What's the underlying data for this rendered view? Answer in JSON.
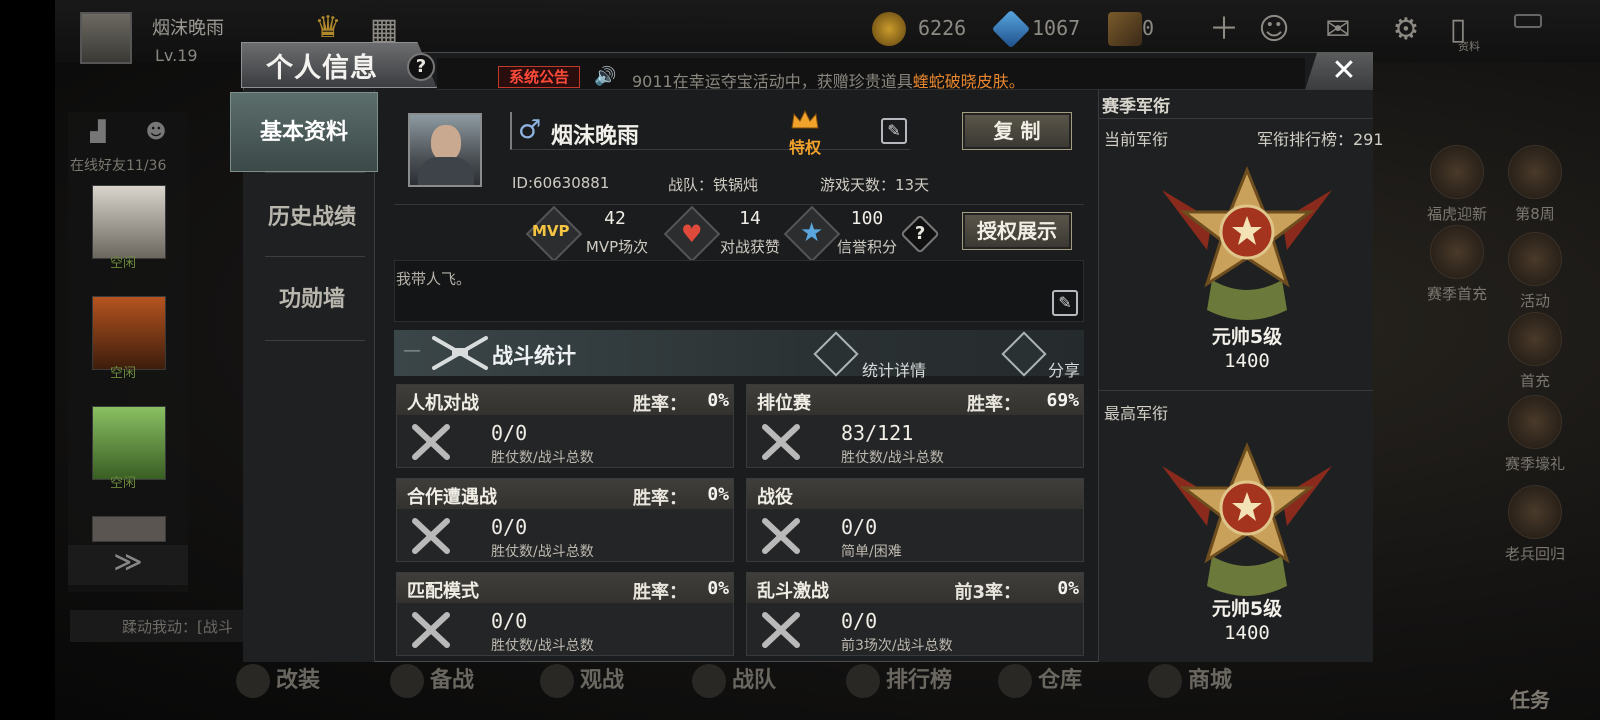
{
  "topbar": {
    "player_name": "烟沫晚雨",
    "level": "Lv.19",
    "gold": "6226",
    "diamonds": "1067",
    "tickets": "0",
    "book_label": "资料"
  },
  "friends": {
    "online_count": "在线好友11/36",
    "status_idle": "空闲",
    "chat_preview": "蹂动我动：[战斗"
  },
  "right_menu": [
    "福虎迎新",
    "第8周",
    "赛季首充",
    "活动",
    "首充",
    "赛季壕礼",
    "老兵回归"
  ],
  "bottom_nav": [
    "改装",
    "备战",
    "观战",
    "战队",
    "排行榜",
    "仓库",
    "商城"
  ],
  "task_label": "任务",
  "modal": {
    "title": "个人信息",
    "help": "?",
    "notice_badge": "系统公告",
    "notice_text": "9011在幸运夺宝活动中，获赠珍贵道具",
    "notice_highlight": "蝰蛇破晓皮肤。",
    "close": "✕"
  },
  "tabs": [
    "基本资料",
    "历史战绩",
    "功勋墙"
  ],
  "profile": {
    "gender_symbol": "♂",
    "name": "烟沫晚雨",
    "privilege": "特权",
    "copy_button": "复 制",
    "id": "ID:60630881",
    "team": "战队：铁锅炖",
    "days": "游戏天数：13天",
    "mvp_icon": "MVP",
    "mvp_count": "42",
    "mvp_label": "MVP场次",
    "likes_count": "14",
    "likes_label": "对战获赞",
    "credit_count": "100",
    "credit_label": "信誉积分",
    "auth_button": "授权展示",
    "motto": "我带人飞。"
  },
  "battle": {
    "title": "战斗统计",
    "details_link": "统计详情",
    "share_link": "分享",
    "cards": [
      {
        "title": "人机对战",
        "rate_label": "胜率：",
        "rate": "0%",
        "value": "0/0",
        "sub": "胜仗数/战斗总数"
      },
      {
        "title": "排位赛",
        "rate_label": "胜率：",
        "rate": "69%",
        "value": "83/121",
        "sub": "胜仗数/战斗总数"
      },
      {
        "title": "合作遭遇战",
        "rate_label": "胜率：",
        "rate": "0%",
        "value": "0/0",
        "sub": "胜仗数/战斗总数"
      },
      {
        "title": "战役",
        "rate_label": "",
        "rate": "",
        "value": "0/0",
        "sub": "简单/困难"
      },
      {
        "title": "匹配模式",
        "rate_label": "胜率：",
        "rate": "0%",
        "value": "0/0",
        "sub": "胜仗数/战斗总数"
      },
      {
        "title": "乱斗激战",
        "rate_label": "前3率：",
        "rate": "0%",
        "value": "0/0",
        "sub": "前3场次/战斗总数"
      }
    ]
  },
  "rank": {
    "header": "赛季军衔",
    "current_label": "当前军衔",
    "ranking": "军衔排行榜：291",
    "current_name": "元帅5级",
    "current_points": "1400",
    "highest_label": "最高军衔",
    "highest_name": "元帅5级",
    "highest_points": "1400"
  },
  "colors": {
    "accent_gold": "#f0a22b",
    "notice_red": "#ff4a3a",
    "highlight_orange": "#e8872f",
    "active_tab": "#4b5c5a"
  }
}
